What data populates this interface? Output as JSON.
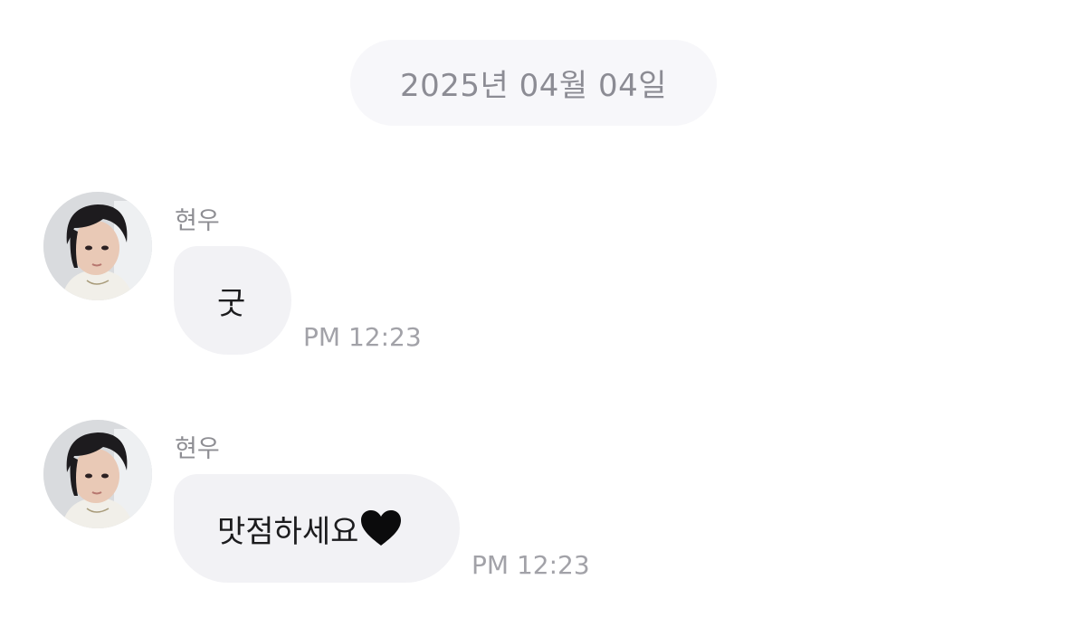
{
  "date_separator": "2025년 04월 04일",
  "messages": [
    {
      "sender": "현우",
      "text": "굿",
      "time": "PM 12:23",
      "emoji": null
    },
    {
      "sender": "현우",
      "text": "맛점하세요",
      "time": "PM 12:23",
      "emoji": "black-heart"
    }
  ]
}
